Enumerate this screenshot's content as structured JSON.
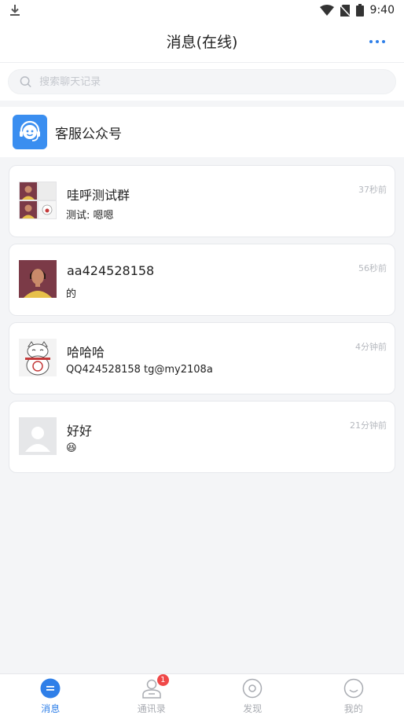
{
  "status_bar": {
    "time": "9:40"
  },
  "header": {
    "title": "消息(在线)"
  },
  "search": {
    "placeholder": "搜索聊天记录"
  },
  "service_account": {
    "label": "客服公众号"
  },
  "chats": [
    {
      "name": "哇呼测试群",
      "preview": "测试: 嗯嗯",
      "time": "37秒前"
    },
    {
      "name": "aa424528158",
      "preview": "的",
      "time": "56秒前"
    },
    {
      "name": "哈哈哈",
      "preview": "QQ424528158 tg@my2108a",
      "time": "4分钟前"
    },
    {
      "name": "好好",
      "preview": "😆",
      "time": "21分钟前"
    }
  ],
  "nav": {
    "items": [
      {
        "label": "消息",
        "icon": "message-icon",
        "active": true
      },
      {
        "label": "通讯录",
        "icon": "contacts-icon",
        "badge": "1"
      },
      {
        "label": "发现",
        "icon": "discover-icon"
      },
      {
        "label": "我的",
        "icon": "profile-icon"
      }
    ]
  },
  "colors": {
    "accent": "#2f7fe8",
    "badge": "#f04848",
    "service_icon_bg": "#3a8ef0"
  }
}
